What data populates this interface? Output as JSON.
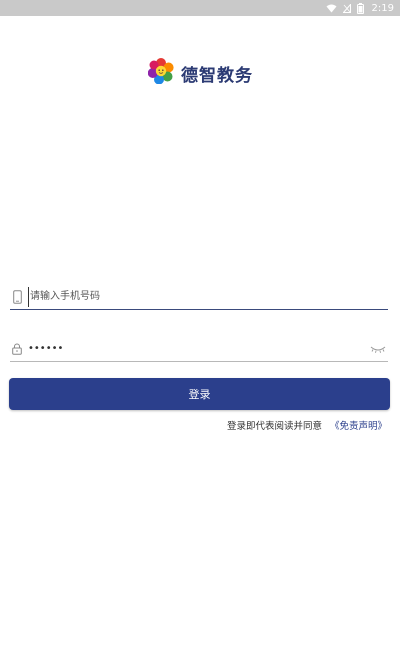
{
  "status_bar": {
    "time": "2:19",
    "icons": [
      "wifi-icon",
      "signal-icon",
      "battery-icon"
    ]
  },
  "brand": {
    "logo": "flower-logo-icon",
    "name": "德智教务"
  },
  "login_form": {
    "phone": {
      "placeholder": "请输入手机号码",
      "value": "",
      "icon": "phone-icon"
    },
    "password": {
      "value": "••••••",
      "icon": "lock-icon",
      "toggle_icon": "eye-closed-icon"
    },
    "submit_label": "登录"
  },
  "agreement": {
    "text": "登录即代表阅读并同意",
    "link_label": "《免责声明》"
  },
  "colors": {
    "primary": "#2b3f8c",
    "brand_text": "#2b3a73",
    "status_bar": "#c9c9c9"
  }
}
